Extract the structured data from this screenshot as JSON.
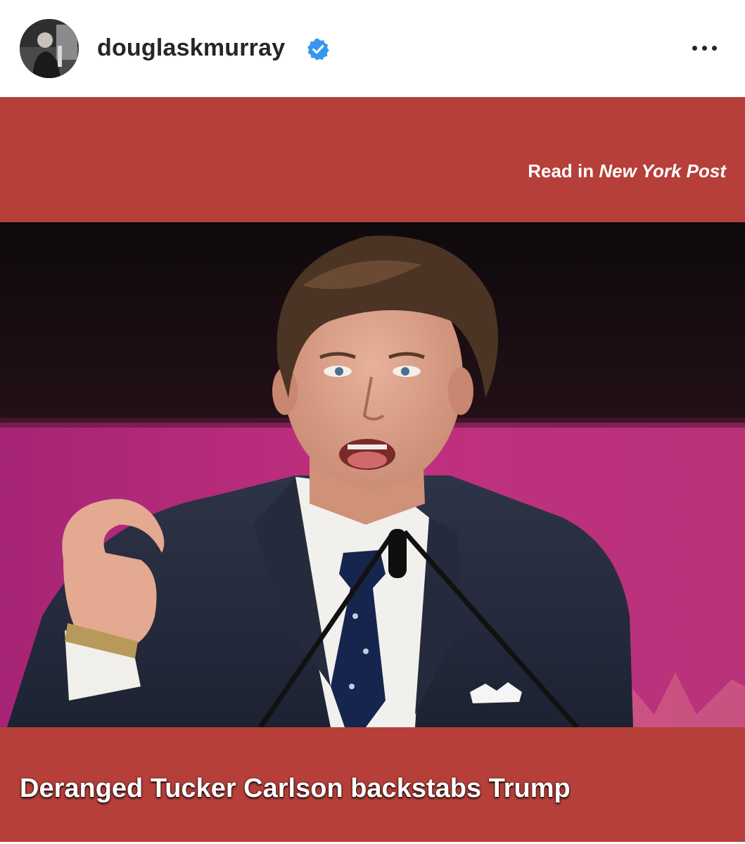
{
  "header": {
    "username": "douglaskmurray",
    "verified": true,
    "avatar_icon": "profile-photo",
    "more_icon": "more-horizontal-icon"
  },
  "post": {
    "read_in_prefix": "Read in ",
    "read_in_source": "New York Post",
    "headline": "Deranged Tucker Carlson backstabs Trump",
    "photo_description_icon": "speaker-at-podium-photo"
  },
  "colors": {
    "card_background": "#b63f39",
    "verified_blue": "#3797f0",
    "text_dark": "#262626",
    "stage_magenta": "#b8287a"
  }
}
